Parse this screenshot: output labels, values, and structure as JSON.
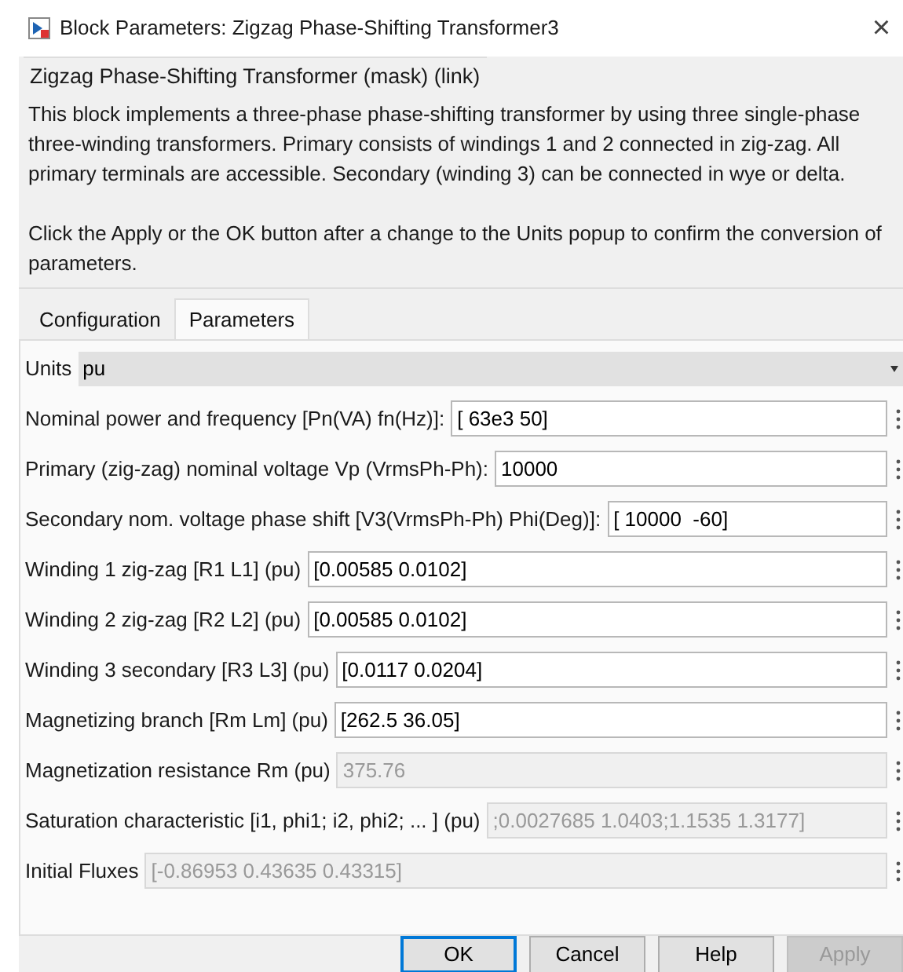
{
  "window": {
    "title": "Block Parameters: Zigzag Phase-Shifting Transformer3",
    "close": "×"
  },
  "mask_title": "Zigzag Phase-Shifting Transformer (mask) (link)",
  "description": [
    "This block implements a three-phase phase-shifting transformer by using three single-phase three-winding transformers. Primary consists of windings 1 and 2 connected in zig-zag. All primary terminals are  accessible. Secondary (winding 3) can be connected in wye or delta.",
    "Click the Apply or the OK button after a change to the Units popup to confirm the conversion of parameters."
  ],
  "tabs": [
    {
      "label": "Configuration",
      "selected": false
    },
    {
      "label": "Parameters",
      "selected": true
    }
  ],
  "units": {
    "label": "Units",
    "value": "pu"
  },
  "parameters": [
    {
      "label": "Nominal power and frequency [Pn(VA)  fn(Hz)]:",
      "value": "[ 63e3 50]",
      "disabled": false
    },
    {
      "label": "Primary (zig-zag) nominal voltage Vp (VrmsPh-Ph):",
      "value": "10000",
      "disabled": false
    },
    {
      "label": "Secondary nom. voltage  phase shift [V3(VrmsPh-Ph) Phi(Deg)]:",
      "value": "[ 10000  -60]",
      "disabled": false
    },
    {
      "label": "Winding 1 zig-zag  [R1 L1] (pu)",
      "value": "[0.00585 0.0102]",
      "disabled": false
    },
    {
      "label": "Winding 2 zig-zag  [R2 L2] (pu)",
      "value": "[0.00585 0.0102]",
      "disabled": false
    },
    {
      "label": "Winding 3 secondary  [R3 L3] (pu)",
      "value": "[0.0117 0.0204]",
      "disabled": false
    },
    {
      "label": "Magnetizing branch  [Rm Lm] (pu)",
      "value": "[262.5 36.05]",
      "disabled": false
    },
    {
      "label": "Magnetization resistance  Rm (pu)",
      "value": "375.76",
      "disabled": true
    },
    {
      "label": "Saturation characteristic  [i1, phi1; i2, phi2; ... ] (pu)",
      "value": ";0.0027685 1.0403;1.1535 1.3177]",
      "disabled": true
    },
    {
      "label": "Initial Fluxes",
      "value": "[-0.86953 0.43635 0.43315]",
      "disabled": true
    }
  ],
  "buttons": [
    {
      "label": "OK",
      "default": true,
      "disabled": false
    },
    {
      "label": "Cancel",
      "default": false,
      "disabled": false
    },
    {
      "label": "Help",
      "default": false,
      "disabled": false
    },
    {
      "label": "Apply",
      "default": false,
      "disabled": true
    }
  ]
}
